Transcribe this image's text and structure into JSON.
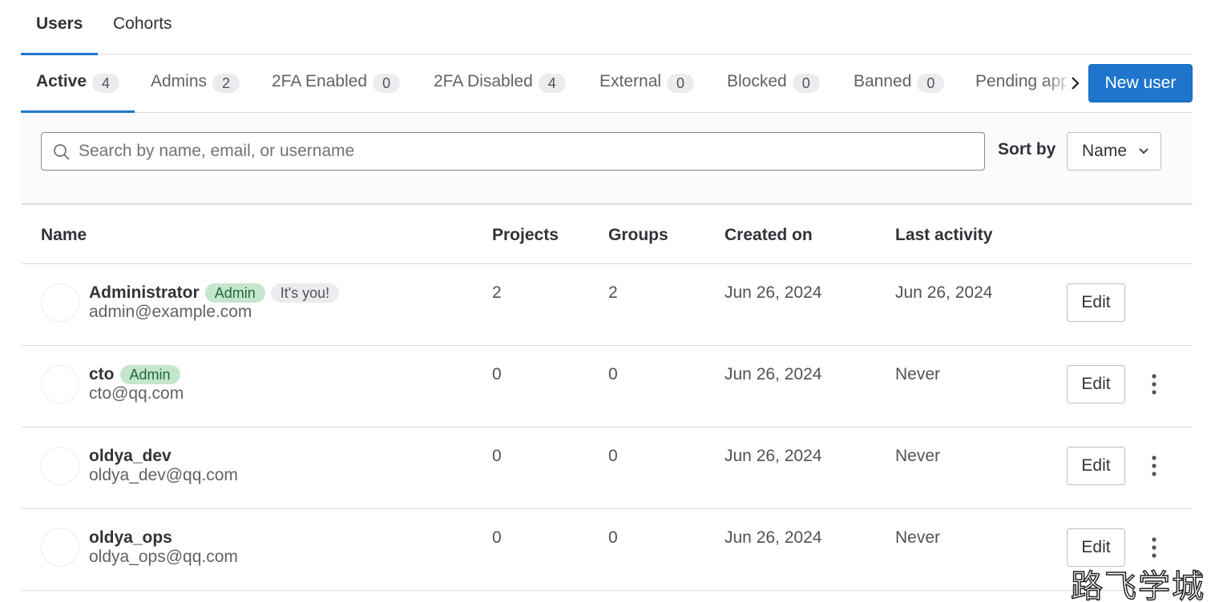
{
  "top_tabs": [
    {
      "label": "Users",
      "active": true
    },
    {
      "label": "Cohorts",
      "active": false
    }
  ],
  "filter_tabs": [
    {
      "label": "Active",
      "count": "4",
      "active": true
    },
    {
      "label": "Admins",
      "count": "2"
    },
    {
      "label": "2FA Enabled",
      "count": "0"
    },
    {
      "label": "2FA Disabled",
      "count": "4"
    },
    {
      "label": "External",
      "count": "0"
    },
    {
      "label": "Blocked",
      "count": "0"
    },
    {
      "label": "Banned",
      "count": "0"
    },
    {
      "label": "Pending approval"
    }
  ],
  "new_user_button": "New user",
  "search": {
    "placeholder": "Search by name, email, or username",
    "value": ""
  },
  "sort": {
    "label": "Sort by",
    "selected": "Name"
  },
  "table": {
    "headers": {
      "name": "Name",
      "projects": "Projects",
      "groups": "Groups",
      "created_on": "Created on",
      "last_activity": "Last activity"
    },
    "edit_label": "Edit",
    "rows": [
      {
        "name": "Administrator",
        "badges": [
          "Admin",
          "It's you!"
        ],
        "email": "admin@example.com",
        "projects": "2",
        "groups": "2",
        "created_on": "Jun 26, 2024",
        "last_activity": "Jun 26, 2024",
        "has_more_actions": false
      },
      {
        "name": "cto",
        "badges": [
          "Admin"
        ],
        "email": "cto@qq.com",
        "projects": "0",
        "groups": "0",
        "created_on": "Jun 26, 2024",
        "last_activity": "Never",
        "has_more_actions": true
      },
      {
        "name": "oldya_dev",
        "badges": [],
        "email": "oldya_dev@qq.com",
        "projects": "0",
        "groups": "0",
        "created_on": "Jun 26, 2024",
        "last_activity": "Never",
        "has_more_actions": true
      },
      {
        "name": "oldya_ops",
        "badges": [],
        "email": "oldya_ops@qq.com",
        "projects": "0",
        "groups": "0",
        "created_on": "Jun 26, 2024",
        "last_activity": "Never",
        "has_more_actions": true
      }
    ]
  },
  "watermark": "路飞学城",
  "colors": {
    "accent": "#1f75cb",
    "admin_badge": "#c3e6cd",
    "neutral_badge": "#ececef"
  },
  "icons": {
    "search": "search-icon",
    "sort_dropdown": "chevron-down-icon",
    "scroll": "chevron-right-icon",
    "row_actions": "kebab-menu-icon"
  }
}
